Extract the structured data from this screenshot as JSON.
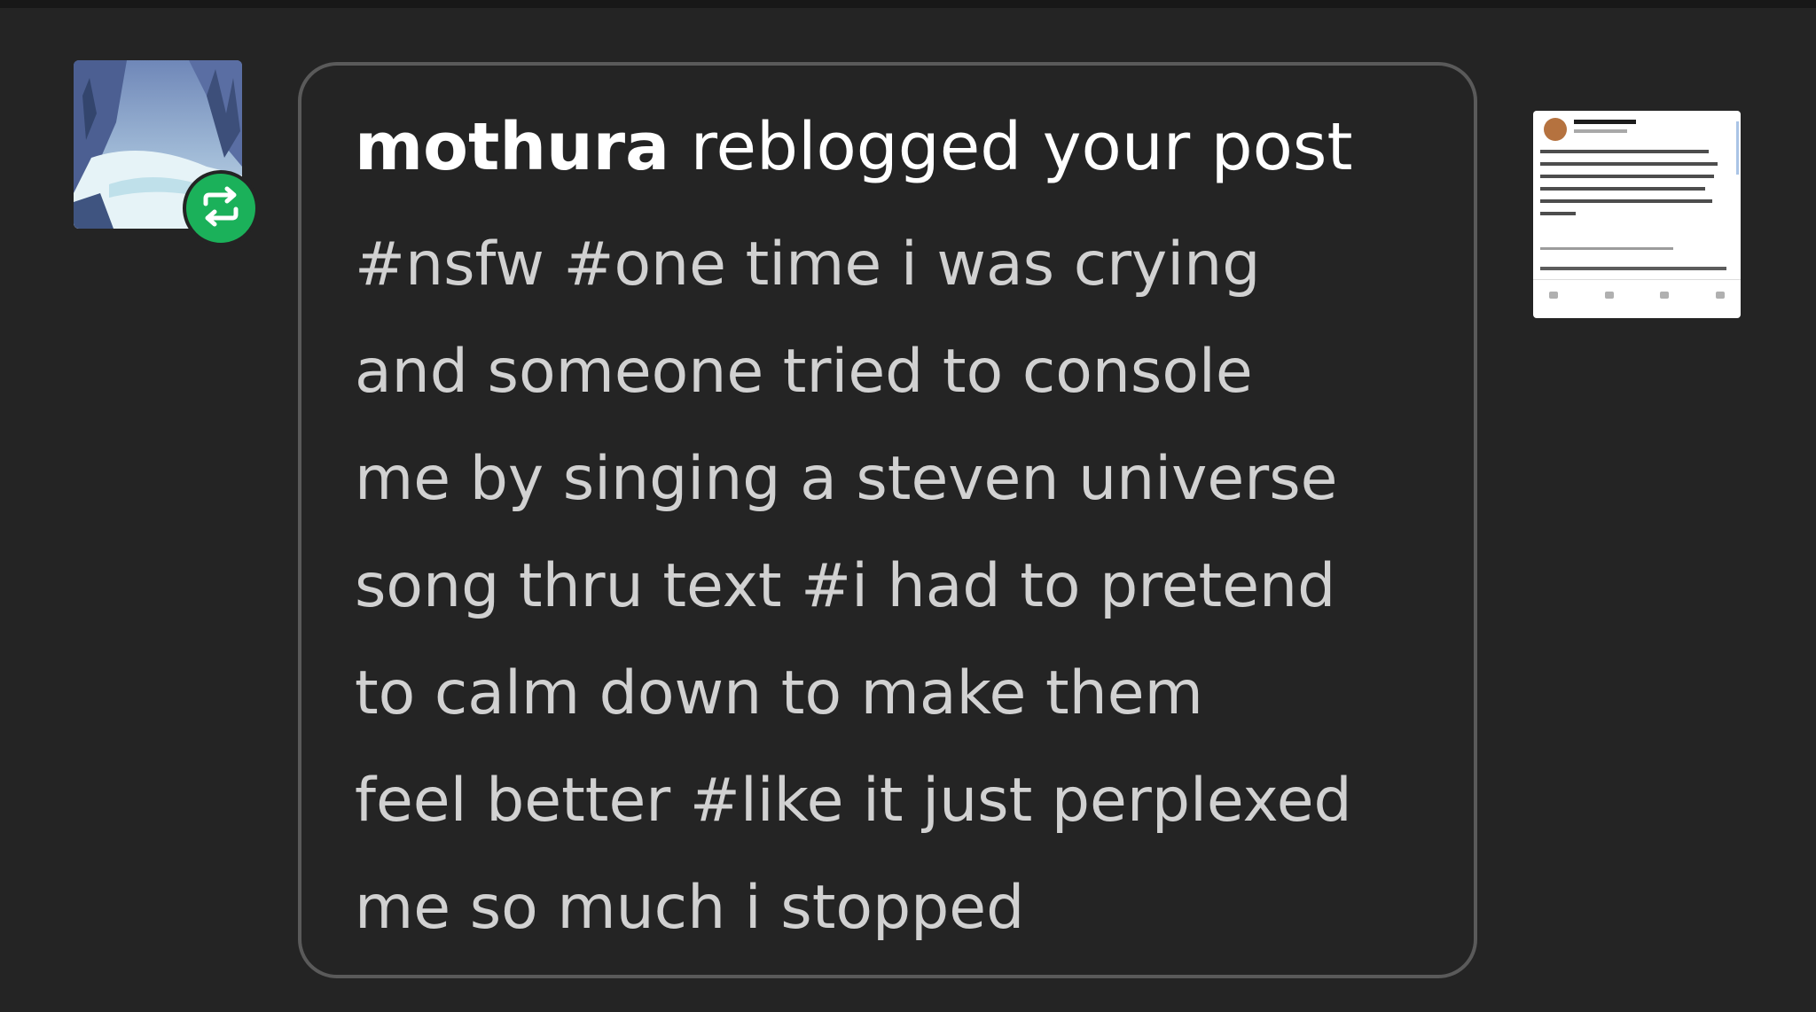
{
  "notification": {
    "username": "mothura",
    "action": "reblogged your post",
    "tags_lines": [
      "#nsfw #one time i was crying",
      "and someone tried to console",
      "me by singing a steven universe",
      "song thru text #i had to pretend",
      "to calm down to make them",
      "feel better #like it just perplexed",
      "me so much i stopped"
    ]
  },
  "avatar": {
    "icon": "landscape-avatar"
  },
  "badge": {
    "icon": "reblog-icon",
    "color": "#1bb15a"
  },
  "post_thumbnail": {
    "icon": "tweet-screenshot-thumbnail"
  }
}
